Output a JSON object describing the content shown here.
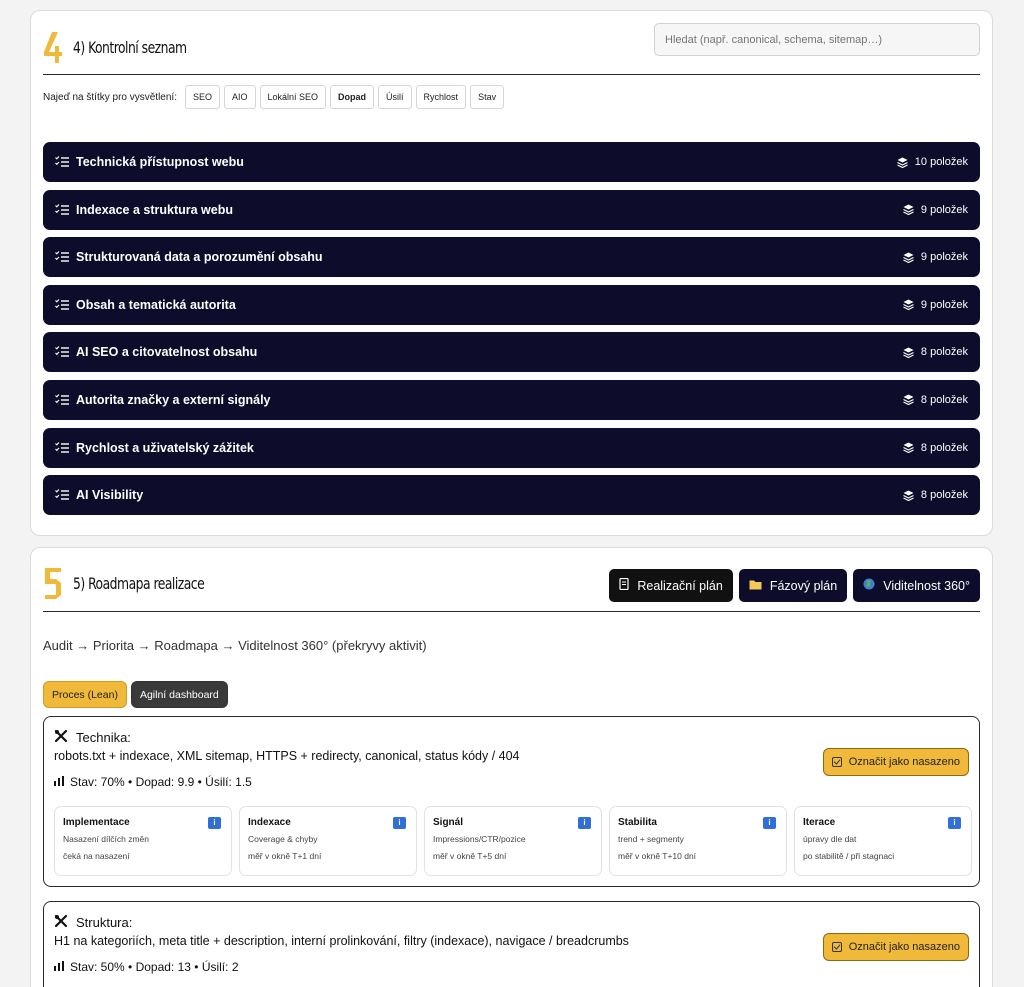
{
  "checklist": {
    "number": "4",
    "title": "4) Kontrolní seznam",
    "search_placeholder": "Hledat (např. canonical, schema, sitemap…)",
    "hint": "Najeď na štítky pro vysvětlení:",
    "tags": [
      "SEO",
      "AIO",
      "Lokální SEO",
      "Dopad",
      "Úsilí",
      "Rychlost",
      "Stav"
    ],
    "categories": [
      {
        "label": "Technická přístupnost webu",
        "count": "10 položek"
      },
      {
        "label": "Indexace a struktura webu",
        "count": "9 položek"
      },
      {
        "label": "Strukturovaná data a porozumění obsahu",
        "count": "9 položek"
      },
      {
        "label": "Obsah a tematická autorita",
        "count": "9 položek"
      },
      {
        "label": "AI SEO a citovatelnost obsahu",
        "count": "8 položek"
      },
      {
        "label": "Autorita značky a externí signály",
        "count": "8 položek"
      },
      {
        "label": "Rychlost a uživatelský zážitek",
        "count": "8 položek"
      },
      {
        "label": "AI Visibility",
        "count": "8 položek"
      }
    ]
  },
  "roadmap": {
    "number": "5",
    "title": "5) Roadmapa realizace",
    "buttons": [
      "Realizační plán",
      "Fázový plán",
      "Viditelnost 360°"
    ],
    "flow": "Audit → Priorita → Roadmapa → Viditelnost 360° (překryvy aktivit)",
    "pills": [
      "Proces (Lean)",
      "Agilní dashboard"
    ],
    "items": [
      {
        "title": "Technika:",
        "desc": "robots.txt + indexace, XML sitemap, HTTPS + redirecty, canonical, status kódy / 404",
        "stat": "Stav: 70% • Dopad: 9.9 • Úsilí: 1.5",
        "button": "Označit jako nasazeno",
        "phases": [
          {
            "title": "Implementace",
            "l1": "Nasazení dílčích změn",
            "l2": "čeká na nasazení"
          },
          {
            "title": "Indexace",
            "l1": "Coverage & chyby",
            "l2": "měř v okně T+1 dní"
          },
          {
            "title": "Signál",
            "l1": "Impressions/CTR/pozice",
            "l2": "měř v okně T+5 dní"
          },
          {
            "title": "Stabilita",
            "l1": "trend + segmenty",
            "l2": "měř v okně T+10 dní"
          },
          {
            "title": "Iterace",
            "l1": "úpravy dle dat",
            "l2": "po stabilitě / při stagnaci"
          }
        ]
      },
      {
        "title": "Struktura:",
        "desc": "H1 na kategoriích, meta title + description, interní prolinkování, filtry (indexace), navigace / breadcrumbs",
        "stat": "Stav: 50% • Dopad: 13 • Úsilí: 2",
        "button": "Označit jako nasazeno"
      }
    ]
  },
  "colors": {
    "accent_yellow": "#f0b93a",
    "navy": "#0d0d2b",
    "info_blue": "#2f6fd6"
  }
}
